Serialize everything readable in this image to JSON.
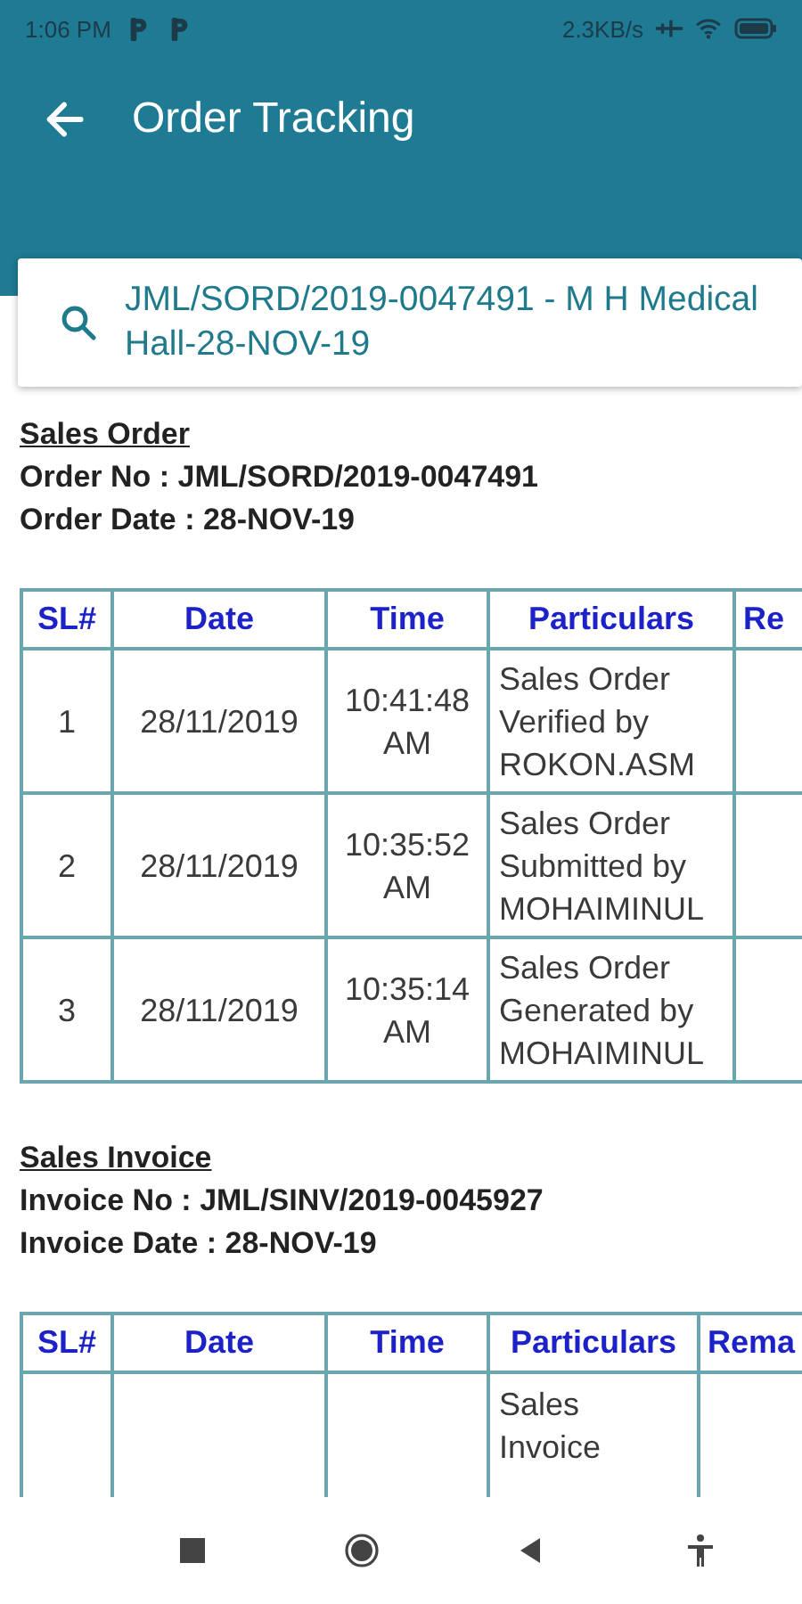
{
  "status_bar": {
    "time": "1:06 PM",
    "speed": "2.3KB/s"
  },
  "app_bar": {
    "title": "Order Tracking"
  },
  "search": {
    "value": "JML/SORD/2019-0047491 - M H Medical Hall-28-NOV-19"
  },
  "sections": [
    {
      "heading": "Sales Order",
      "lines": [
        "Order No : JML/SORD/2019-0047491",
        "Order Date : 28-NOV-19"
      ],
      "table": {
        "columns": [
          "SL#",
          "Date",
          "Time",
          "Particulars",
          "Re"
        ],
        "rows": [
          {
            "sl": "1",
            "date": "28/11/2019",
            "time": "10:41:48 AM",
            "particulars": "Sales Order Verified by ROKON.ASM"
          },
          {
            "sl": "2",
            "date": "28/11/2019",
            "time": "10:35:52 AM",
            "particulars": "Sales Order Submitted by MOHAIMINUL"
          },
          {
            "sl": "3",
            "date": "28/11/2019",
            "time": "10:35:14 AM",
            "particulars": "Sales Order Generated by MOHAIMINUL"
          }
        ]
      }
    },
    {
      "heading": "Sales Invoice",
      "lines": [
        "Invoice No : JML/SINV/2019-0045927",
        "Invoice Date : 28-NOV-19"
      ],
      "table": {
        "columns": [
          "SL#",
          "Date",
          "Time",
          "Particulars",
          "Rema"
        ],
        "rows": [
          {
            "particulars": "Sales Invoice"
          }
        ]
      }
    }
  ]
}
